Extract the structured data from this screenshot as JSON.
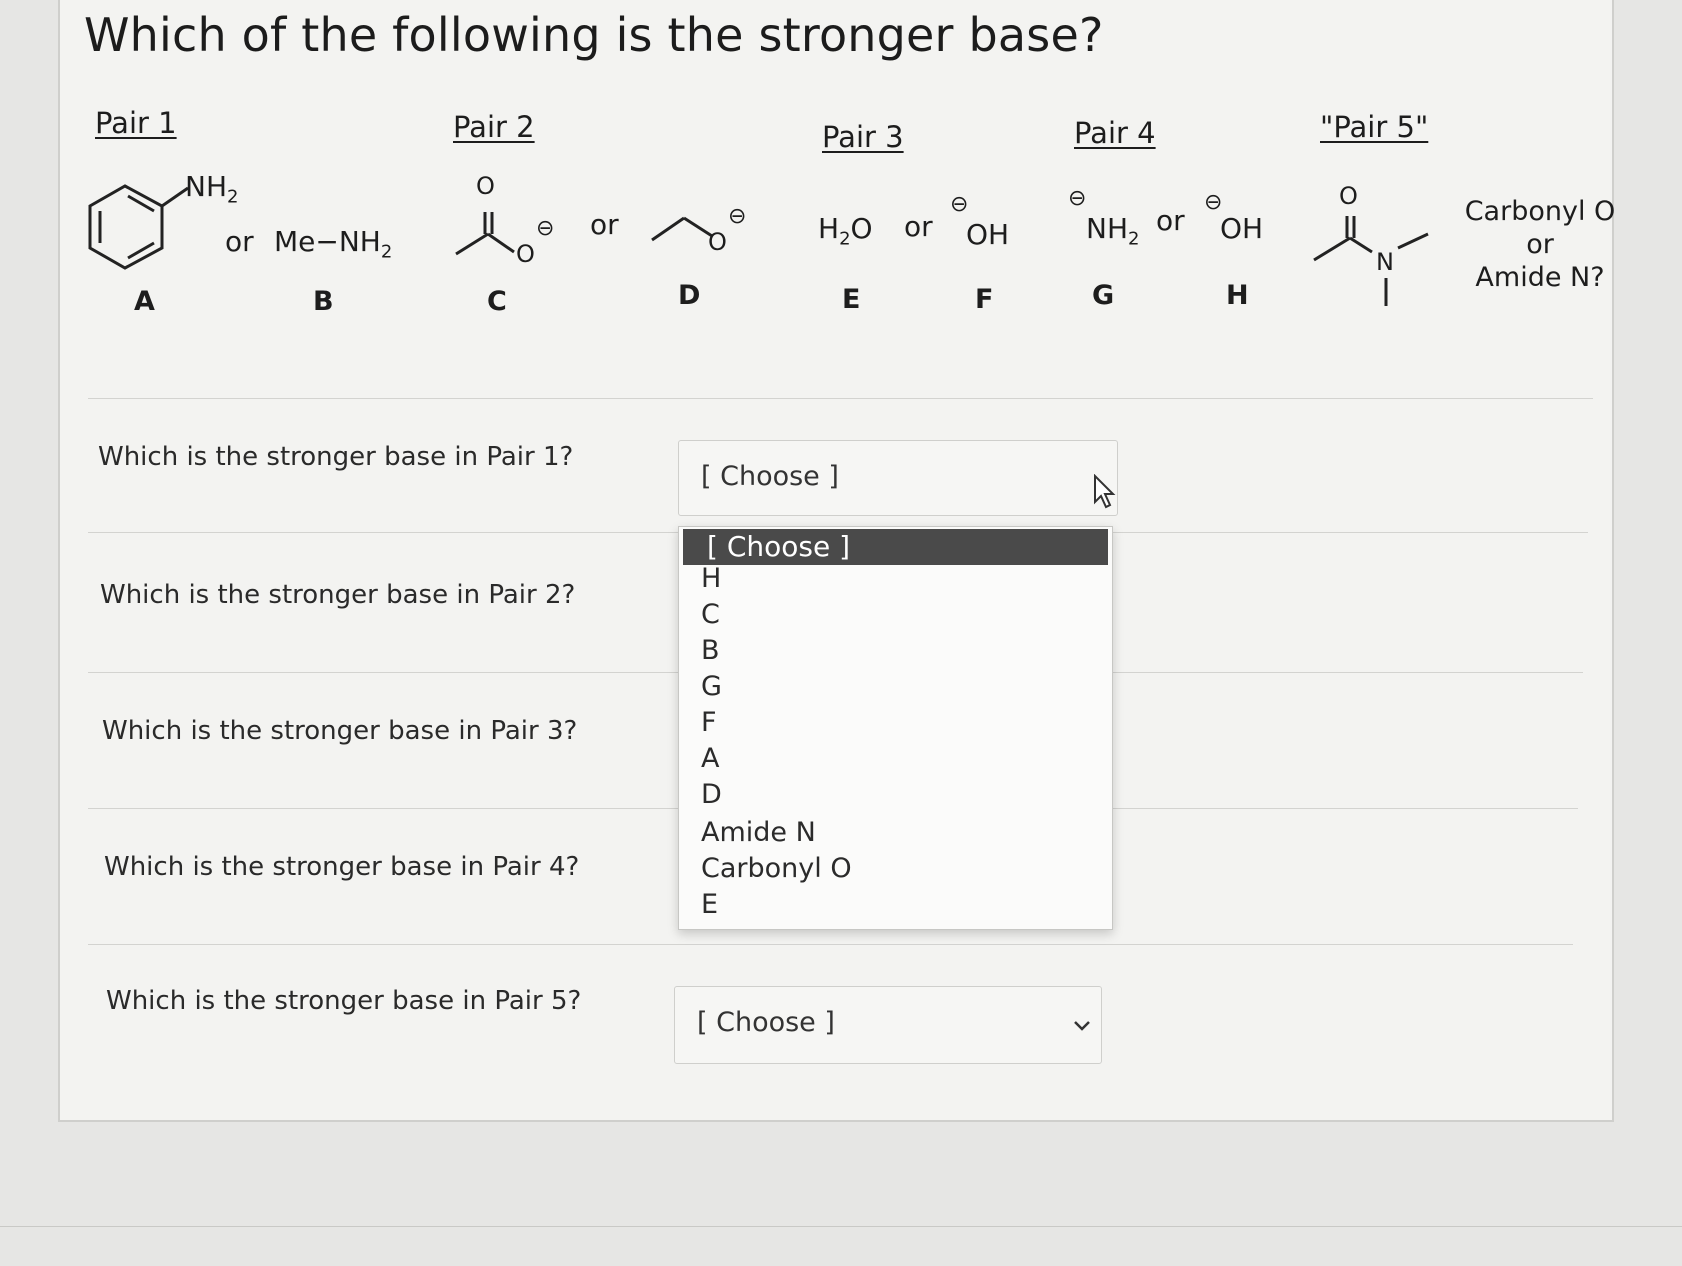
{
  "title": "Which of the following is the stronger base?",
  "pairs": [
    {
      "heading": "Pair 1",
      "left_label": "A",
      "right_label": "B",
      "or_text": "or",
      "right_formula": "Me−NH",
      "right_sub": "2",
      "left_group": "NH",
      "left_sub": "2"
    },
    {
      "heading": "Pair 2",
      "left_label": "C",
      "right_label": "D",
      "or_text": "or"
    },
    {
      "heading": "Pair 3",
      "left_label": "E",
      "right_label": "F",
      "or_text": "or",
      "left_formula": "H",
      "left_sub": "2",
      "left_tail": "O",
      "right_formula": "OH"
    },
    {
      "heading": "Pair 4",
      "left_label": "G",
      "right_label": "H",
      "or_text": "or",
      "left_formula": "NH",
      "left_sub": "2",
      "right_formula": "OH"
    },
    {
      "heading": "\"Pair 5\"",
      "text_line1": "Carbonyl O",
      "text_line2": "or",
      "text_line3": "Amide N?"
    }
  ],
  "atoms": {
    "O": "O",
    "N": "N",
    "charge": "⊖"
  },
  "questions": [
    {
      "text": "Which is the stronger base in Pair 1?",
      "value": "[ Choose ]"
    },
    {
      "text": "Which is the stronger base in Pair 2?"
    },
    {
      "text": "Which is the stronger base in Pair 3?"
    },
    {
      "text": "Which is the stronger base in Pair 4?"
    },
    {
      "text": "Which is the stronger base in Pair 5?",
      "value": "[ Choose ]"
    }
  ],
  "dropdown": {
    "selected": "[ Choose ]",
    "options": [
      "H",
      "C",
      "B",
      "G",
      "F",
      "A",
      "D",
      "Amide N",
      "Carbonyl O",
      "E"
    ]
  },
  "icons": {
    "chevron": "chevron-down-icon",
    "cursor": "mouse-pointer-icon"
  },
  "colors": {
    "selected_bg": "#4a4a4a",
    "card_bg": "#f3f3f1"
  }
}
